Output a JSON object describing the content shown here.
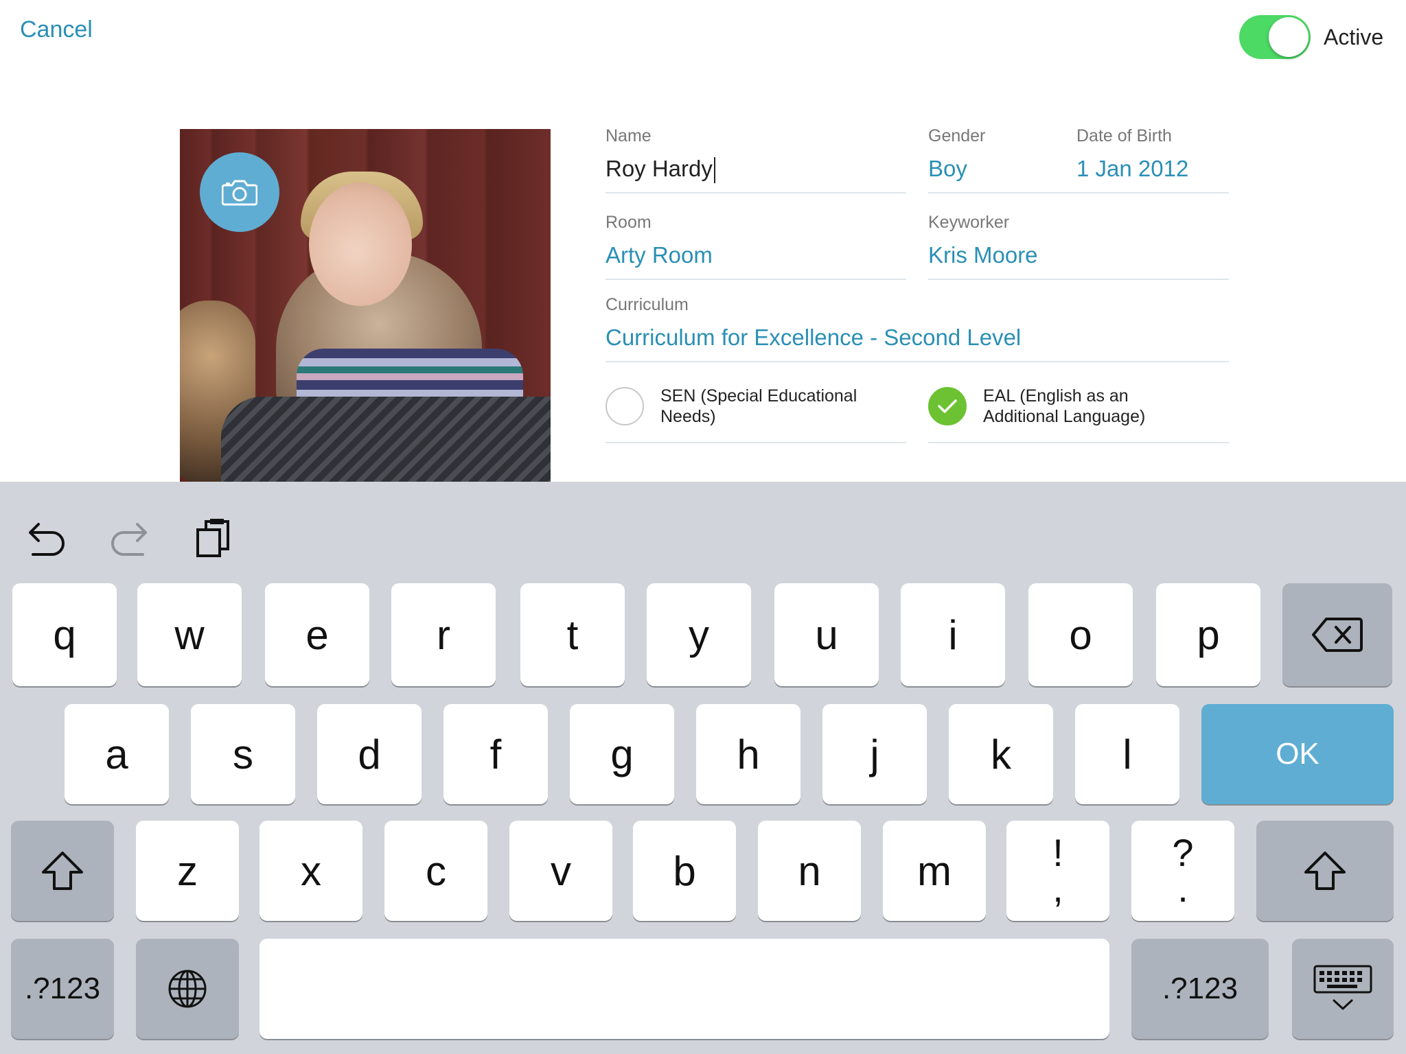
{
  "header": {
    "cancel_label": "Cancel",
    "active_label": "Active",
    "active_on": true,
    "toggle_color": "#4cd964"
  },
  "form": {
    "name_label": "Name",
    "name_value": "Roy Hardy",
    "gender_label": "Gender",
    "gender_value": "Boy",
    "dob_label": "Date of Birth",
    "dob_value": "1 Jan 2012",
    "room_label": "Room",
    "room_value": "Arty Room",
    "keyworker_label": "Keyworker",
    "keyworker_value": "Kris Moore",
    "curriculum_label": "Curriculum",
    "curriculum_value": "Curriculum for Excellence - Second Level",
    "sen_label": "SEN (Special Educational Needs)",
    "sen_checked": false,
    "eal_label": "EAL (English as an Additional Language)",
    "eal_checked": true,
    "accent_color": "#2a8fb5"
  },
  "photo": {
    "camera_icon": "camera-icon"
  },
  "keyboard": {
    "toolbar": [
      "undo-icon",
      "redo-icon",
      "paste-icon"
    ],
    "row1": [
      "q",
      "w",
      "e",
      "r",
      "t",
      "y",
      "u",
      "i",
      "o",
      "p"
    ],
    "row2": [
      "a",
      "s",
      "d",
      "f",
      "g",
      "h",
      "j",
      "k",
      "l"
    ],
    "row3": [
      "z",
      "x",
      "c",
      "v",
      "b",
      "n",
      "m"
    ],
    "punct1_top": "!",
    "punct1_bottom": ",",
    "punct2_top": "?",
    "punct2_bottom": ".",
    "ok_label": "OK",
    "numbers_label": ".?123",
    "ok_color": "#5fadd3"
  }
}
